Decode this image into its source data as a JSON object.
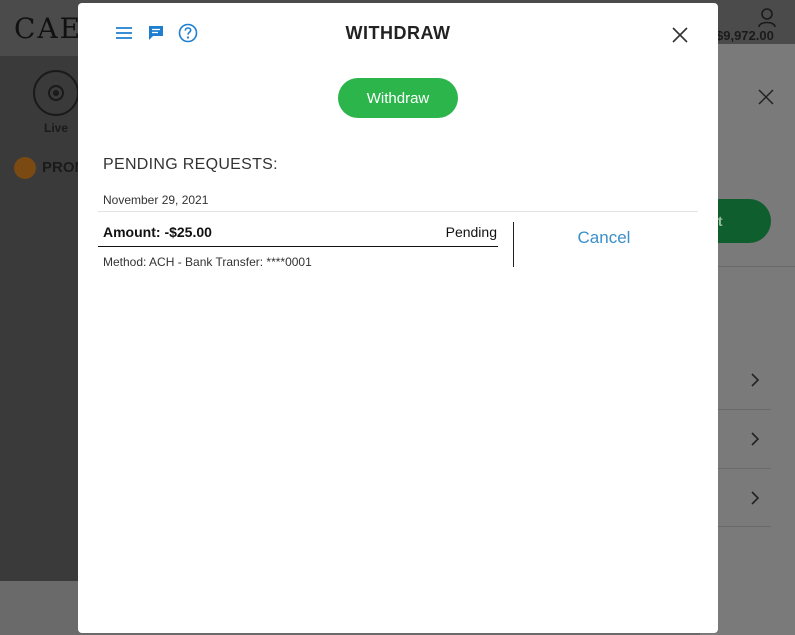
{
  "background": {
    "logo_text": "CAES",
    "balance": "$9,972.00",
    "live_label": "Live",
    "promo_label": "PROM",
    "deposit_label": "it"
  },
  "modal": {
    "title": "WITHDRAW",
    "header_icons": [
      "menu-icon",
      "chat-icon",
      "help-icon"
    ],
    "withdraw_button": "Withdraw",
    "pending_heading": "PENDING REQUESTS:",
    "request": {
      "date": "November 29, 2021",
      "amount_label": "Amount:",
      "amount_value": "-$25.00",
      "status": "Pending",
      "method": "Method: ACH - Bank Transfer: ****0001",
      "cancel_label": "Cancel"
    }
  },
  "colors": {
    "accent_green": "#2bb54b",
    "link_blue": "#3a8fc9",
    "icon_blue": "#1e7fd0"
  }
}
